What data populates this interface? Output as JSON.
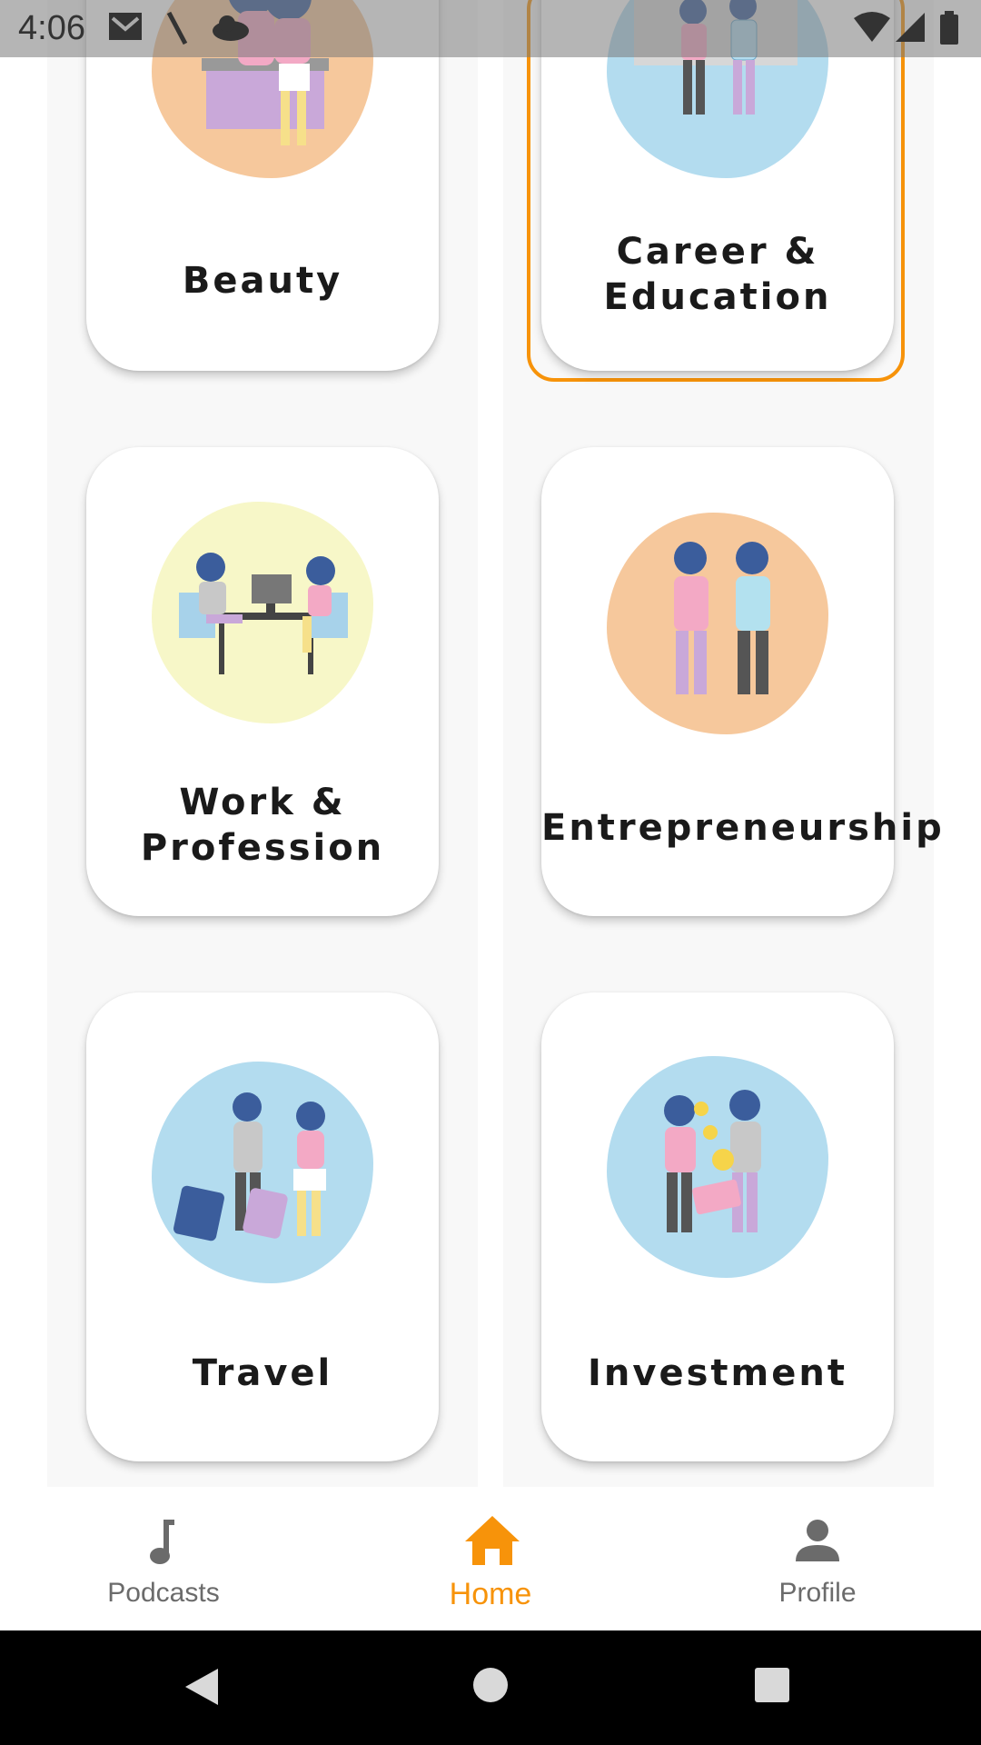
{
  "status_bar": {
    "time": "4:06",
    "icons": [
      "gmail-icon",
      "pen-icon",
      "cloud-icon",
      "wifi-icon",
      "signal-icon",
      "battery-icon"
    ]
  },
  "categories": [
    {
      "label_lines": [
        "Beauty"
      ],
      "blob_color": "#f6c89c",
      "illustration": "beauty-illustration"
    },
    {
      "label_lines": [
        "Career &",
        "Education"
      ],
      "blob_color": "#b3dcef",
      "illustration": "career-education-illustration",
      "selected": true
    },
    {
      "label_lines": [
        "Work &",
        "Profession"
      ],
      "blob_color": "#f7f7c8",
      "illustration": "work-profession-illustration"
    },
    {
      "label_lines": [
        "Entrepreneurship"
      ],
      "blob_color": "#f6c89c",
      "illustration": "entrepreneurship-illustration"
    },
    {
      "label_lines": [
        "Travel"
      ],
      "blob_color": "#b3dcef",
      "illustration": "travel-illustration"
    },
    {
      "label_lines": [
        "Investment"
      ],
      "blob_color": "#b3dcef",
      "illustration": "investment-illustration"
    }
  ],
  "bottom_nav": {
    "items": [
      {
        "label": "Podcasts",
        "icon": "music-note-icon"
      },
      {
        "label": "Home",
        "icon": "home-icon",
        "active": true
      },
      {
        "label": "Profile",
        "icon": "person-icon"
      }
    ]
  },
  "colors": {
    "accent": "#f7930a",
    "inactive": "#6b6b6b",
    "peach": "#f6c89c",
    "light_blue": "#b3dcef",
    "light_yellow": "#f7f7c8"
  }
}
